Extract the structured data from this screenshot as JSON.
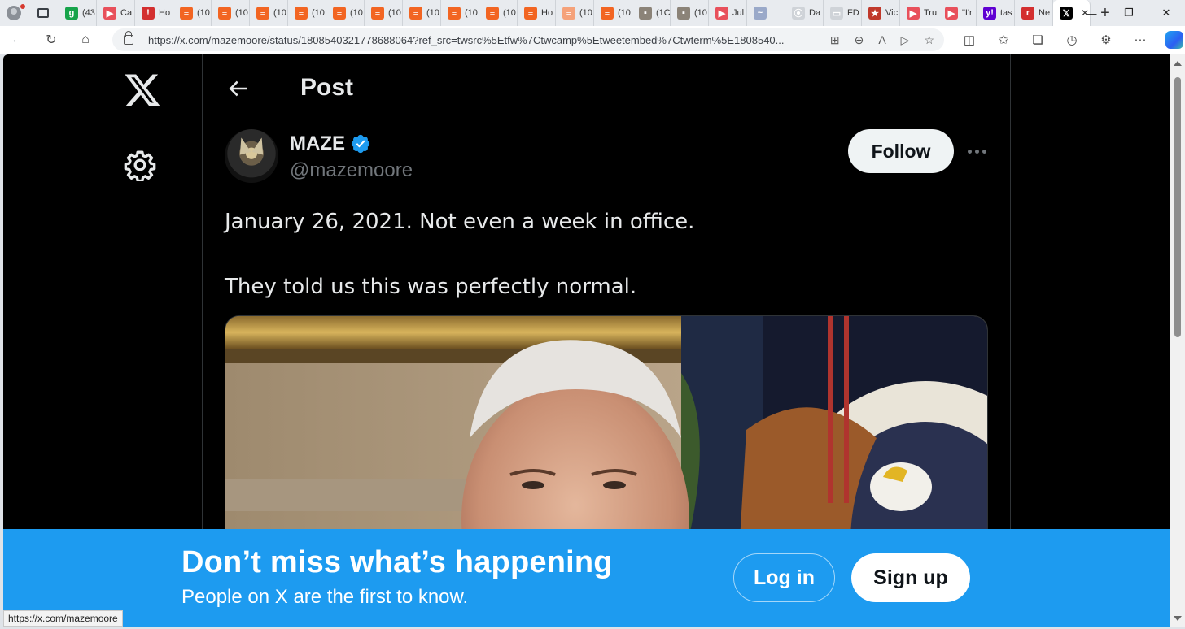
{
  "browser": {
    "tabs": [
      {
        "label": "(43",
        "favicon_color": "#16a34a",
        "favicon_char": "g"
      },
      {
        "label": "Ca",
        "favicon_color": "#e8505b",
        "favicon_char": "▶"
      },
      {
        "label": "Ho",
        "favicon_color": "#d32f2f",
        "favicon_char": "!"
      },
      {
        "label": "(10",
        "favicon_color": "#f26522",
        "favicon_char": "≡"
      },
      {
        "label": "(10",
        "favicon_color": "#f26522",
        "favicon_char": "≡"
      },
      {
        "label": "(10",
        "favicon_color": "#f26522",
        "favicon_char": "≡"
      },
      {
        "label": "(10",
        "favicon_color": "#f26522",
        "favicon_char": "≡"
      },
      {
        "label": "(10",
        "favicon_color": "#f26522",
        "favicon_char": "≡"
      },
      {
        "label": "(10",
        "favicon_color": "#f26522",
        "favicon_char": "≡"
      },
      {
        "label": "(10",
        "favicon_color": "#f26522",
        "favicon_char": "≡"
      },
      {
        "label": "(10",
        "favicon_color": "#f26522",
        "favicon_char": "≡"
      },
      {
        "label": "(10",
        "favicon_color": "#f26522",
        "favicon_char": "≡"
      },
      {
        "label": "Ho",
        "favicon_color": "#f26522",
        "favicon_char": "≡"
      },
      {
        "label": "(10",
        "favicon_color": "#f5a27a",
        "favicon_char": "≡"
      },
      {
        "label": "(10",
        "favicon_color": "#f26522",
        "favicon_char": "≡"
      },
      {
        "label": "(1C",
        "favicon_color": "#8b8378",
        "favicon_char": "▪"
      },
      {
        "label": "(10",
        "favicon_color": "#8b8378",
        "favicon_char": "▪"
      },
      {
        "label": "Jul",
        "favicon_color": "#e8505b",
        "favicon_char": "▶"
      },
      {
        "label": "",
        "favicon_color": "#9aa9c9",
        "favicon_char": "~"
      },
      {
        "label": "Da",
        "favicon_color": "#cfd3d8",
        "favicon_char": "⦿"
      },
      {
        "label": "FD",
        "favicon_color": "#cfd3d8",
        "favicon_char": "▭"
      },
      {
        "label": "Vic",
        "favicon_color": "#c0392b",
        "favicon_char": "★"
      },
      {
        "label": "Tru",
        "favicon_color": "#e8505b",
        "favicon_char": "▶"
      },
      {
        "label": "\"I'r",
        "favicon_color": "#e8505b",
        "favicon_char": "▶"
      },
      {
        "label": "tas",
        "favicon_color": "#6001d2",
        "favicon_char": "y!"
      },
      {
        "label": "Ne",
        "favicon_color": "#d32f2f",
        "favicon_char": "r"
      },
      {
        "label": "",
        "favicon_color": "#000000",
        "favicon_char": "𝕏",
        "active": true
      }
    ],
    "url": "https://x.com/mazemoore/status/1808540321778688064?ref_src=twsrc%5Etfw%7Ctwcamp%5Etweetembed%7Ctwterm%5E1808540...",
    "status_url": "https://x.com/mazemoore"
  },
  "page": {
    "header_title": "Post",
    "author": {
      "name": "MAZE",
      "handle": "@mazemoore",
      "verified_color": "#1d9bf0"
    },
    "follow_label": "Follow",
    "tweet_lines": [
      "January 26, 2021. Not even a week in office.",
      "They told us this was perfectly normal."
    ],
    "media_icon": "video-thumbnail"
  },
  "banner": {
    "title": "Don’t miss what’s happening",
    "subtitle": "People on X are the first to know.",
    "login_label": "Log in",
    "signup_label": "Sign up",
    "background": "#1d9bf0"
  }
}
